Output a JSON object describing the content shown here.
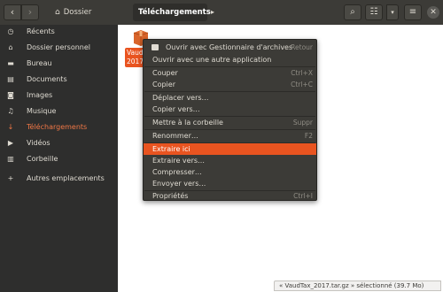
{
  "header": {
    "back_glyph": "‹",
    "forward_glyph": "›",
    "breadcrumb_home": "Dossier personnel",
    "breadcrumb_current": "Téléchargements",
    "breadcrumb_arrow": "▸",
    "search_glyph": "⌕",
    "view_glyph": "☷",
    "sort_glyph": "▾",
    "menu_glyph": "≡",
    "close_glyph": "✕"
  },
  "sidebar": {
    "items": [
      {
        "label": "Récents",
        "icon": "clock-icon",
        "glyph": "◷"
      },
      {
        "label": "Dossier personnel",
        "icon": "home-icon",
        "glyph": "⌂"
      },
      {
        "label": "Bureau",
        "icon": "folder-icon",
        "glyph": "▬"
      },
      {
        "label": "Documents",
        "icon": "document-icon",
        "glyph": "▤"
      },
      {
        "label": "Images",
        "icon": "camera-icon",
        "glyph": "◙"
      },
      {
        "label": "Musique",
        "icon": "music-icon",
        "glyph": "♫"
      },
      {
        "label": "Téléchargements",
        "icon": "download-icon",
        "glyph": "↓",
        "active": true
      },
      {
        "label": "Vidéos",
        "icon": "video-icon",
        "glyph": "▶"
      },
      {
        "label": "Corbeille",
        "icon": "trash-icon",
        "glyph": "▥"
      },
      {
        "label": "Autres emplacements",
        "icon": "plus-icon",
        "glyph": "+"
      }
    ]
  },
  "file": {
    "label_line1": "Vaud",
    "label_line2": "2017."
  },
  "context_menu": {
    "items": [
      {
        "label": "Ouvrir avec Gestionnaire d'archives",
        "accel": "Retour"
      },
      {
        "label": "Ouvrir avec une autre application",
        "accel": ""
      },
      {
        "label": "Couper",
        "accel": "Ctrl+X"
      },
      {
        "label": "Copier",
        "accel": "Ctrl+C"
      },
      {
        "label": "Déplacer vers…",
        "accel": ""
      },
      {
        "label": "Copier vers…",
        "accel": ""
      },
      {
        "label": "Mettre à la corbeille",
        "accel": "Suppr"
      },
      {
        "label": "Renommer…",
        "accel": "F2"
      },
      {
        "label": "Extraire ici",
        "accel": "",
        "highlighted": true
      },
      {
        "label": "Extraire vers…",
        "accel": ""
      },
      {
        "label": "Compresser…",
        "accel": ""
      },
      {
        "label": "Envoyer vers…",
        "accel": ""
      },
      {
        "label": "Propriétés",
        "accel": "Ctrl+I"
      }
    ]
  },
  "status": {
    "text": "« VaudTax_2017.tar.gz » sélectionné  (39.7 Mo)"
  },
  "colors": {
    "accent": "#e95420",
    "active_sidebar": "#f07746",
    "header_bg": "#3c3b37",
    "sidebar_bg": "#2e2e2d"
  }
}
